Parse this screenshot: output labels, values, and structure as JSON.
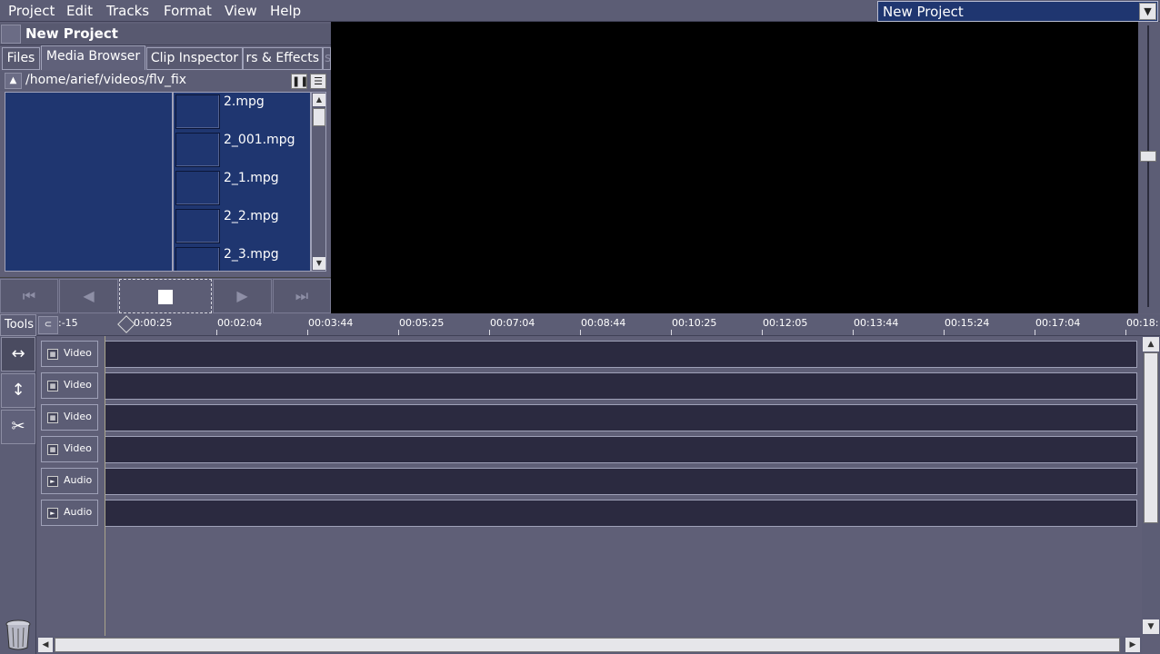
{
  "menubar": {
    "items": [
      "Project",
      "Edit",
      "Tracks",
      "Format",
      "View",
      "Help"
    ]
  },
  "project_select": {
    "value": "New Project"
  },
  "panel": {
    "title": "New Project",
    "tabs": [
      "Files",
      "Media Browser",
      "Clip Inspector",
      "rs & Effects",
      "s"
    ],
    "active_tab": "Media Browser",
    "path": "/home/arief/videos/flv_fix"
  },
  "files": [
    "2.mpg",
    "2_001.mpg",
    "2_1.mpg",
    "2_2.mpg",
    "2_3.mpg"
  ],
  "ruler": {
    "start_label": ":-15",
    "ticks": [
      "0:00:25",
      "00:02:04",
      "00:03:44",
      "00:05:25",
      "00:07:04",
      "00:08:44",
      "00:10:25",
      "00:12:05",
      "00:13:44",
      "00:15:24",
      "00:17:04",
      "00:18:"
    ]
  },
  "tools": {
    "label": "Tools"
  },
  "tracks": [
    {
      "type": "video",
      "label": "Video"
    },
    {
      "type": "video",
      "label": "Video"
    },
    {
      "type": "video",
      "label": "Video"
    },
    {
      "type": "video",
      "label": "Video"
    },
    {
      "type": "audio",
      "label": "Audio"
    },
    {
      "type": "audio",
      "label": "Audio"
    }
  ],
  "colors": {
    "accent": "#1f3670",
    "panel": "#5c5d75",
    "lane": "#2b2a40",
    "viewer": "#000000"
  }
}
